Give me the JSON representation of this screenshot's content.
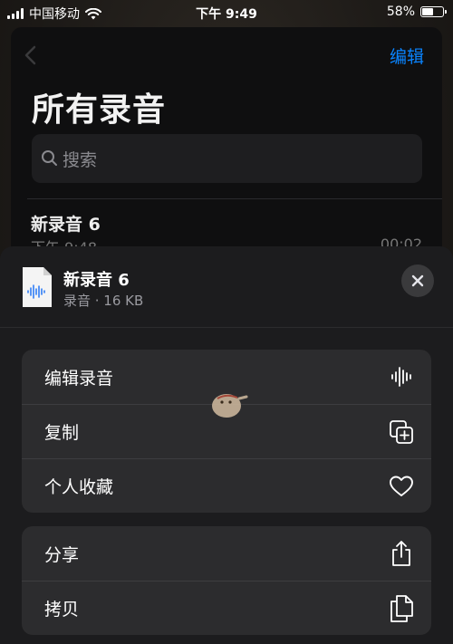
{
  "status_bar": {
    "carrier": "中国移动",
    "time": "下午 9:49",
    "battery": "58%",
    "battery_level": 0.58
  },
  "background_screen": {
    "edit_label": "编辑",
    "title": "所有录音",
    "search_placeholder": "搜索",
    "recording": {
      "title": "新录音 6",
      "time": "下午 9:48",
      "duration": "00:02"
    }
  },
  "sheet": {
    "file_name": "新录音 6",
    "file_meta": "录音 · 16 KB",
    "group1": [
      {
        "label": "编辑录音",
        "icon": "waveform-icon"
      },
      {
        "label": "复制",
        "icon": "duplicate-icon"
      },
      {
        "label": "个人收藏",
        "icon": "heart-icon"
      }
    ],
    "group2": [
      {
        "label": "分享",
        "icon": "share-icon"
      },
      {
        "label": "拷贝",
        "icon": "copy-icon"
      }
    ]
  },
  "colors": {
    "accent": "#0a84ff",
    "sheet_bg": "#1c1c1e",
    "row_bg": "#2c2c2e"
  }
}
